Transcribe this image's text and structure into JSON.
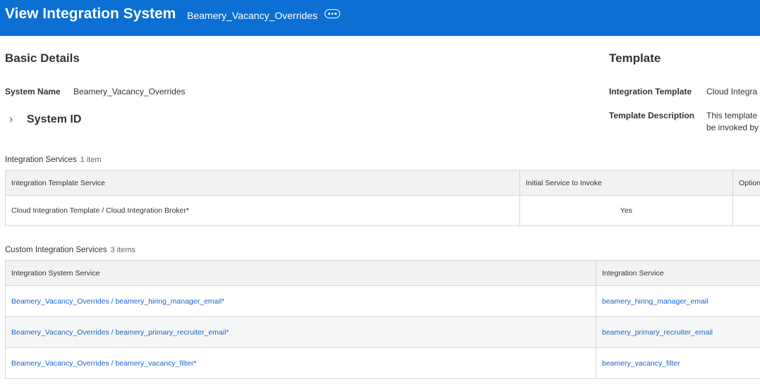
{
  "header": {
    "title": "View Integration System",
    "subtitle": "Beamery_Vacancy_Overrides"
  },
  "basic_details": {
    "heading": "Basic Details",
    "system_name_label": "System Name",
    "system_name_value": "Beamery_Vacancy_Overrides",
    "system_id_label": "System ID"
  },
  "template": {
    "heading": "Template",
    "integration_template_label": "Integration Template",
    "integration_template_value": "Cloud Integra",
    "template_description_label": "Template Description",
    "template_description_line1": "This template",
    "template_description_line2": "be invoked by"
  },
  "integration_services": {
    "title": "Integration Services",
    "count": "1 item",
    "columns": [
      "Integration Template Service",
      "Initial Service to Invoke",
      "Option"
    ],
    "rows": [
      [
        "Cloud Integration Template / Cloud Integration Broker*",
        "Yes",
        ""
      ]
    ]
  },
  "custom_services": {
    "title": "Custom Integration Services",
    "count": "3 items",
    "columns": [
      "Integration System Service",
      "Integration Service"
    ],
    "rows": [
      [
        "Beamery_Vacancy_Overrides / beamery_hiring_manager_email*",
        "beamery_hiring_manager_email"
      ],
      [
        "Beamery_Vacancy_Overrides / beamery_primary_recruiter_email*",
        "beamery_primary_recruiter_email"
      ],
      [
        "Beamery_Vacancy_Overrides / beamery_vacancy_filter*",
        "beamery_vacancy_filter"
      ]
    ]
  }
}
